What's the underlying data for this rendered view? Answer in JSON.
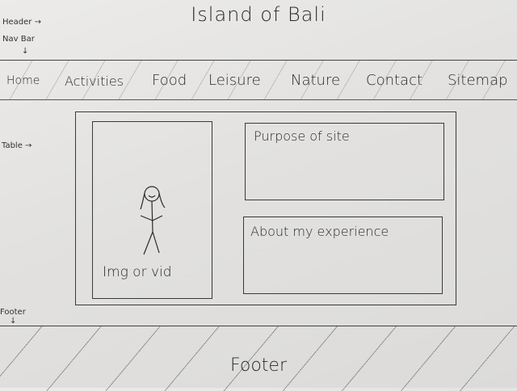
{
  "header": {
    "title": "Island of Bali"
  },
  "annotations": {
    "header": "Header →",
    "nav_bar": "Nav Bar",
    "down_arrow": "↓",
    "table": "Table →",
    "footer": "Footer",
    "footer_arrow": "↓"
  },
  "nav": {
    "items": [
      {
        "label": "Home"
      },
      {
        "label": "Activities"
      },
      {
        "label": "Food"
      },
      {
        "label": "Leisure"
      },
      {
        "label": "Nature"
      },
      {
        "label": "Contact"
      },
      {
        "label": "Sitemap"
      }
    ]
  },
  "table": {
    "media_label": "Img or vid",
    "purpose_label": "Purpose of site",
    "about_label": "About my experience"
  },
  "footer": {
    "label": "Footer"
  }
}
